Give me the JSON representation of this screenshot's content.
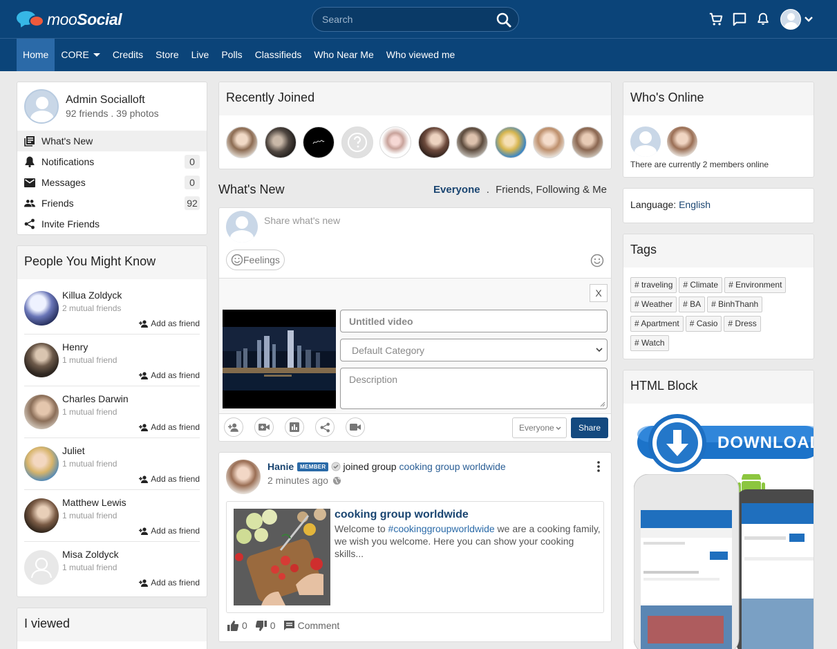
{
  "brand": {
    "name_a": "moo",
    "name_b": "Social"
  },
  "search": {
    "placeholder": "Search"
  },
  "topbar_icons": [
    "cart-icon",
    "chat-icon",
    "bell-icon",
    "avatar",
    "chevron-down-icon"
  ],
  "nav": {
    "items": [
      {
        "label": "Home",
        "active": true
      },
      {
        "label": "CORE",
        "has_dropdown": true
      },
      {
        "label": "Credits"
      },
      {
        "label": "Store"
      },
      {
        "label": "Live"
      },
      {
        "label": "Polls"
      },
      {
        "label": "Classifieds"
      },
      {
        "label": "Who Near Me"
      },
      {
        "label": "Who viewed me"
      }
    ]
  },
  "profile": {
    "name": "Admin Socialloft",
    "stats": "92 friends . 39 photos",
    "menu": [
      {
        "label": "What's New",
        "icon": "newsfeed-icon",
        "selected": true
      },
      {
        "label": "Notifications",
        "icon": "bell-icon",
        "count": "0"
      },
      {
        "label": "Messages",
        "icon": "mail-icon",
        "count": "0"
      },
      {
        "label": "Friends",
        "icon": "people-icon",
        "count": "92"
      },
      {
        "label": "Invite Friends",
        "icon": "share-icon"
      }
    ]
  },
  "pymk": {
    "title": "People You Might Know",
    "add_label": "Add as friend",
    "people": [
      {
        "name": "Killua Zoldyck",
        "mutual": "2 mutual friends"
      },
      {
        "name": "Henry",
        "mutual": "1 mutual friend"
      },
      {
        "name": "Charles Darwin",
        "mutual": "1 mutual friend"
      },
      {
        "name": "Juliet",
        "mutual": "1 mutual friend"
      },
      {
        "name": "Matthew Lewis",
        "mutual": "1 mutual friend"
      },
      {
        "name": "Misa Zoldyck",
        "mutual": "1 mutual friend"
      }
    ]
  },
  "i_viewed": {
    "title": "I viewed"
  },
  "recently_joined": {
    "title": "Recently Joined"
  },
  "whats_new": {
    "title": "What's New",
    "filter_active": "Everyone",
    "filter_sep": ".",
    "filter_other": "Friends, Following & Me"
  },
  "composer": {
    "placeholder": "Share what's new",
    "feelings": "Feelings",
    "close": "X",
    "video_title_placeholder": "Untitled video",
    "category_default": "Default Category",
    "description_placeholder": "Description",
    "privacy": "Everyone",
    "share": "Share"
  },
  "post": {
    "author": "Hanie",
    "badge": "MEMBER",
    "action": "joined group",
    "group": "cooking group worldwide",
    "time": "2 minutes ago",
    "embed_title": "cooking group worldwide",
    "embed_desc_a": "Welcome to ",
    "embed_hashtag": "#cookinggroupworldwide",
    "embed_desc_b": " we are a cooking family, we wish you welcome. Here you can show your cooking skills...",
    "likes": "0",
    "dislikes": "0",
    "comment": "Comment"
  },
  "whos_online": {
    "title": "Who's Online",
    "text": "There are currently 2 members online"
  },
  "language": {
    "label": "Language:",
    "value": "English"
  },
  "tags": {
    "title": "Tags",
    "items": [
      "# traveling",
      "# Climate",
      "# Environment",
      "# Weather",
      "# BA",
      "# BinhThanh",
      "# Apartment",
      "# Casio",
      "# Dress",
      "# Watch"
    ]
  },
  "html_block": {
    "title": "HTML Block",
    "download_label": "DOWNLOAD"
  },
  "colors": {
    "primary": "#0b4479",
    "nav_active": "#2b6aa8",
    "link": "#1a4571",
    "share_button": "#13497f"
  }
}
